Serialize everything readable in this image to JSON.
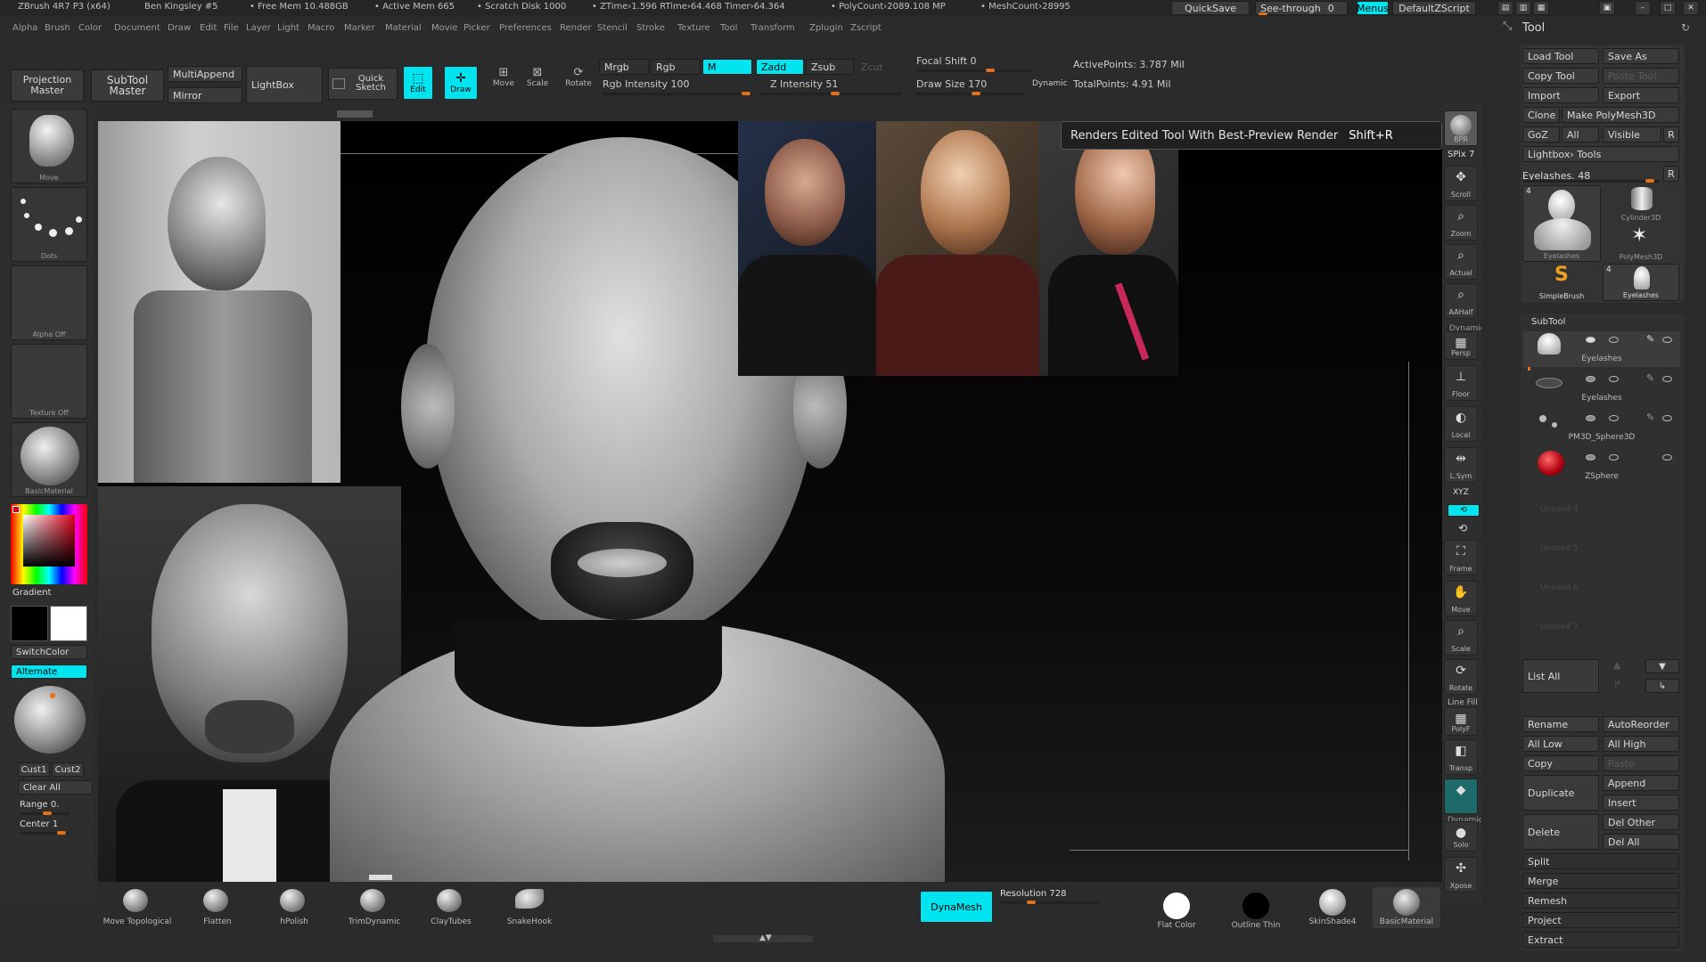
{
  "titlebar": {
    "app": "ZBrush 4R7 P3 (x64)",
    "doc": "Ben Kingsley #5",
    "free_mem": "• Free Mem 10.488GB",
    "active_mem": "• Active Mem 665",
    "scratch": "• Scratch Disk 1000",
    "ztime": "• ZTime›1.596 RTime›64.468 Timer›64.364",
    "polycount": "• PolyCount›2089.108 MP",
    "meshcount": "• MeshCount›28995",
    "quicksave": "QuickSave",
    "seethrough": "See-through",
    "seethrough_val": "0",
    "menus": "Menus",
    "script": "DefaultZScript"
  },
  "menubar": [
    "Alpha",
    "Brush",
    "Color",
    "Document",
    "Draw",
    "Edit",
    "File",
    "Layer",
    "Light",
    "Macro",
    "Marker",
    "Material",
    "Movie",
    "Picker",
    "Preferences",
    "Render",
    "Stencil",
    "Stroke",
    "Texture",
    "Tool",
    "Transform",
    "Zplugin",
    "Zscript"
  ],
  "toolbar": {
    "projection_master": "Projection Master",
    "subtool_master": "SubTool Master",
    "multiappend": "MultiAppend",
    "mirror": "Mirror",
    "lightbox": "LightBox",
    "quick_sketch": "Quick Sketch",
    "edit": "Edit",
    "draw": "Draw",
    "move": "Move",
    "scale": "Scale",
    "rotate": "Rotate",
    "mrgb": "Mrgb",
    "rgb": "Rgb",
    "m": "M",
    "zadd": "Zadd",
    "zsub": "Zsub",
    "zcut": "Zcut",
    "rgb_intensity": "Rgb Intensity 100",
    "z_intensity": "Z Intensity 51",
    "focal_shift": "Focal Shift 0",
    "draw_size": "Draw Size 170",
    "dynamic": "Dynamic",
    "active_points": "ActivePoints: 3.787  Mil",
    "total_points": "TotalPoints: 4.91  Mil"
  },
  "tooltip": {
    "text": "Renders Edited Tool With Best-Preview Render",
    "shortcut": "Shift+R"
  },
  "left_shelf": {
    "move": "Move",
    "dots": "Dots",
    "alpha_off": "Alpha Off",
    "texture_off": "Texture Off",
    "basic_material": "BasicMaterial",
    "gradient": "Gradient",
    "switchcolor": "SwitchColor",
    "alternate": "Alternate",
    "cust1": "Cust1",
    "cust2": "Cust2",
    "clear_all": "Clear All",
    "range": "Range 0.",
    "center": "Center 1"
  },
  "right_shelf": {
    "bpr": "BPR",
    "spix": "SPix 7",
    "scroll": "Scroll",
    "zoom": "Zoom",
    "actual": "Actual",
    "aahalf": "AAHalf",
    "dynamic": "Dynamic",
    "persp": "Persp",
    "floor": "Floor",
    "local": "Local",
    "lsym": "L.Sym",
    "xyz": "XYZ",
    "frame": "Frame",
    "move": "Move",
    "scale": "Scale",
    "rotate": "Rotate",
    "line_fill": "Line Fill",
    "polyf": "PolyF",
    "transp": "Transp",
    "dynamic2": "Dynamic",
    "solo": "Solo",
    "xpose": "Xpose"
  },
  "tool_panel": {
    "title": "Tool",
    "load_tool": "Load Tool",
    "save_as": "Save As",
    "copy_tool": "Copy Tool",
    "paste_tool": "Paste Tool",
    "import": "Import",
    "export": "Export",
    "clone": "Clone",
    "make_polymesh": "Make PolyMesh3D",
    "goz": "GoZ",
    "all": "All",
    "visible": "Visible",
    "r": "R",
    "lightbox_tools": "Lightbox› Tools",
    "eyelashes_slider": "Eyelashes. 48",
    "thumbs": [
      {
        "label": "Eyelashes",
        "count": "4"
      },
      {
        "label": "Cylinder3D",
        "count": ""
      },
      {
        "label": "PolyMesh3D",
        "count": ""
      },
      {
        "label": "SimpleBrush",
        "count": ""
      },
      {
        "label": "Eyelashes",
        "count": "4"
      }
    ],
    "subtool_header": "SubTool",
    "subtools": [
      "Eyelashes",
      "Eyelashes",
      "PM3D_Sphere3D",
      "ZSphere"
    ],
    "unused": [
      "Unused 4",
      "Unused 5",
      "Unused 6",
      "Unused 7"
    ],
    "list_all": "List All",
    "rename": "Rename",
    "autoreorder": "AutoReorder",
    "all_low": "All Low",
    "all_high": "All High",
    "copy": "Copy",
    "paste": "Paste",
    "duplicate": "Duplicate",
    "append": "Append",
    "insert": "Insert",
    "delete": "Delete",
    "del_other": "Del Other",
    "del_all": "Del All",
    "split": "Split",
    "merge": "Merge",
    "remesh": "Remesh",
    "project": "Project",
    "extract": "Extract"
  },
  "bottom_shelf": {
    "brushes": [
      "Move Topological",
      "Flatten",
      "hPolish",
      "TrimDynamic",
      "ClayTubes",
      "SnakeHook"
    ],
    "dynamesh": "DynaMesh",
    "resolution": "Resolution 728",
    "flat_color": "Flat Color",
    "outline_thin": "Outline Thin",
    "skinshade": "SkinShade4",
    "basic_material": "BasicMaterial"
  },
  "colors": {
    "accent_cyan": "#00e4f0",
    "slider_orange": "#e0701a",
    "bg": "#2b2b2b"
  }
}
